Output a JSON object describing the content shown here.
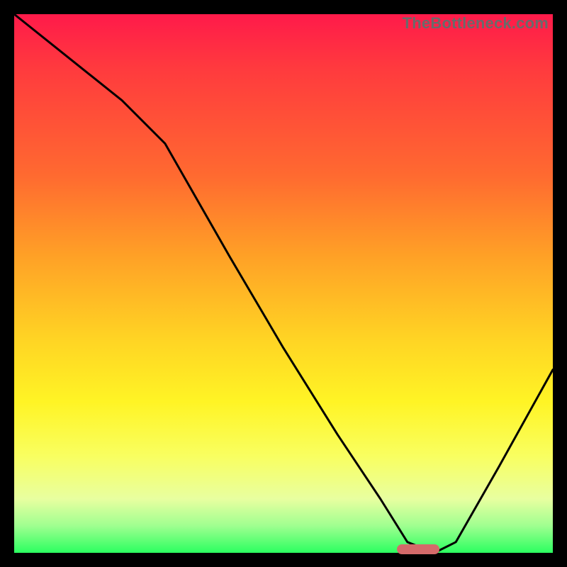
{
  "watermark": "TheBottleneck.com",
  "marker": {
    "x_pct": 75,
    "y_pct": 0
  },
  "chart_data": {
    "type": "line",
    "title": "",
    "xlabel": "",
    "ylabel": "",
    "xlim": [
      0,
      100
    ],
    "ylim": [
      0,
      100
    ],
    "series": [
      {
        "name": "bottleneck-curve",
        "x": [
          0,
          10,
          20,
          28,
          40,
          50,
          60,
          68,
          73,
          78,
          82,
          90,
          100
        ],
        "y": [
          100,
          92,
          84,
          76,
          55,
          38,
          22,
          10,
          2,
          0,
          2,
          16,
          34
        ]
      }
    ],
    "annotations": [
      {
        "name": "optimal-marker",
        "x": 75,
        "y": 0,
        "color": "#d46a6a"
      }
    ]
  }
}
